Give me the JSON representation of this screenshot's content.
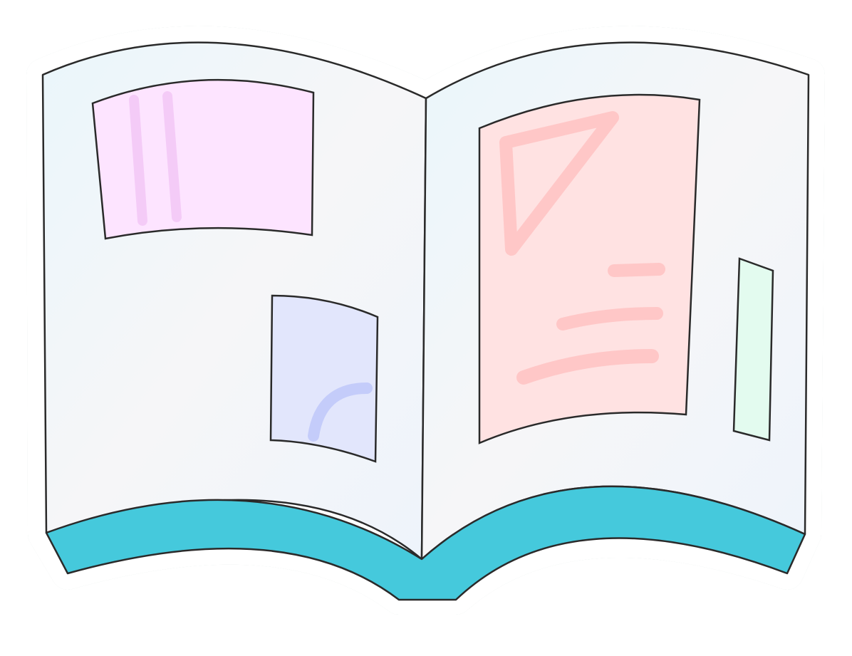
{
  "illustration": {
    "subject": "open-book-icon",
    "colors": {
      "page": "#eef4fa",
      "cover": "#45c9dc",
      "outline": "#2a2a2a",
      "sticker_border": "#ffffff",
      "shadow": "#1f8a6e",
      "panel_pink": "#fde4ff",
      "panel_lavender": "#e2e6fc",
      "panel_salmon": "#ffe2e2",
      "panel_mint": "#e3fbef",
      "chalk_pink": "#f3c6f6",
      "chalk_blue": "#c4ccfa",
      "chalk_red": "#ffc7c7"
    }
  }
}
